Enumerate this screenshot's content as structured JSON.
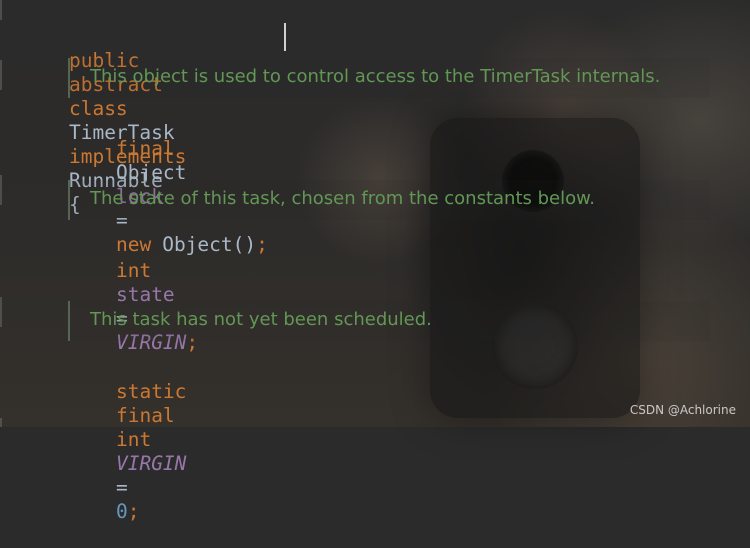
{
  "code": {
    "line1": {
      "kw_public": "public",
      "kw_abstract": "abstract",
      "kw_class": "class",
      "class_name": "TimerTask",
      "kw_implements": "implements",
      "iface": "Runnable",
      "brace": "{"
    },
    "doc1": "This object is used to control access to the TimerTask internals.",
    "line2": {
      "kw_final": "final",
      "type": "Object",
      "field": "lock",
      "eq": "=",
      "kw_new": "new",
      "ctor": "Object()",
      "semi": ";"
    },
    "doc2": "The state of this task, chosen from the constants below.",
    "line3": {
      "kw_int": "int",
      "field": "state",
      "eq": "=",
      "const": "VIRGIN",
      "semi": ";"
    },
    "doc3": "This task has not yet been scheduled.",
    "line4": {
      "kw_static": "static",
      "kw_final": "final",
      "kw_int": "int",
      "const": "VIRGIN",
      "eq": "=",
      "value": "0",
      "semi": ";"
    }
  },
  "watermark": "CSDN @Achlorine",
  "colors": {
    "keyword": "#cc7832",
    "field": "#9876aa",
    "number": "#6897bb",
    "doc": "#629755",
    "text": "#a9b7c6"
  }
}
